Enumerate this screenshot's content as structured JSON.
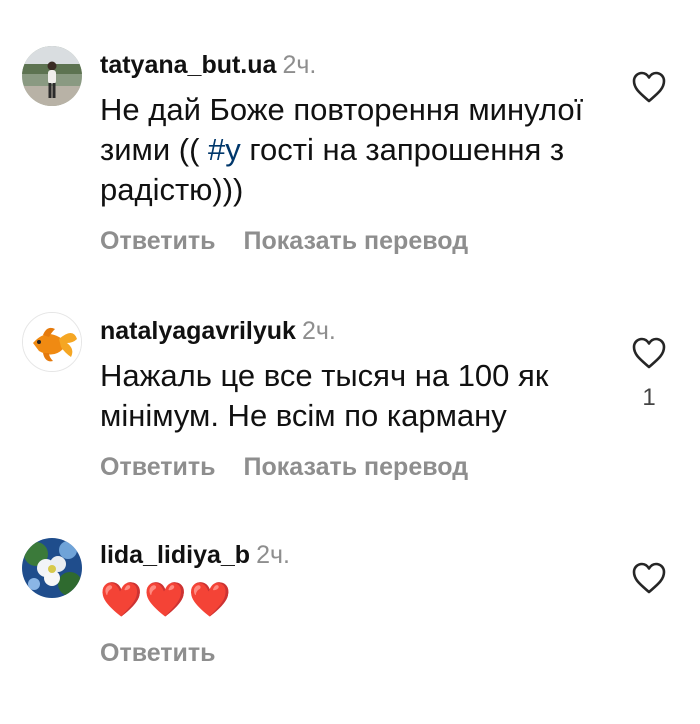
{
  "comments": [
    {
      "username": "tatyana_but.ua",
      "time": "2ч.",
      "text_before": "Не дай Боже повторення минулої зими (( ",
      "hashtag": "#у",
      "text_after": " гості на запрошення з радістю)))",
      "reply_label": "Ответить",
      "translate_label": "Показать перевод",
      "avatar_icon": "person-photo-avatar",
      "like_icon": "heart-outline-icon"
    },
    {
      "username": "natalyagavrilyuk",
      "time": "2ч.",
      "text": "Нажаль це все тысяч на 100 як мінімум.  Не всім по карману",
      "reply_label": "Ответить",
      "translate_label": "Показать перевод",
      "like_count": "1",
      "avatar_icon": "goldfish-avatar",
      "like_icon": "heart-outline-icon"
    },
    {
      "username": "lida_lidiya_b",
      "time": "2ч.",
      "text": "❤️❤️❤️",
      "reply_label": "Ответить",
      "avatar_icon": "flower-photo-avatar",
      "like_icon": "heart-outline-icon"
    }
  ],
  "colors": {
    "username": "#111111",
    "meta": "#8e8e8e",
    "hashtag": "#00376b"
  }
}
